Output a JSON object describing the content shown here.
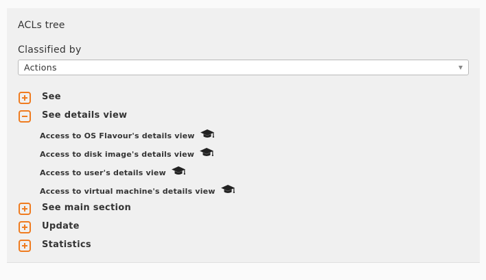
{
  "panel": {
    "title": "ACLs tree"
  },
  "classification": {
    "label": "Classified by",
    "selected": "Actions"
  },
  "tree": [
    {
      "label": "See",
      "expanded": false,
      "icon": "plus-square-icon"
    },
    {
      "label": "See details view",
      "expanded": true,
      "icon": "minus-square-icon",
      "children": [
        {
          "label": "Access to OS Flavour's details view",
          "icon": "graduation-cap-icon"
        },
        {
          "label": "Access to disk image's details view",
          "icon": "graduation-cap-icon"
        },
        {
          "label": "Access to user's details view",
          "icon": "graduation-cap-icon"
        },
        {
          "label": "Access to virtual machine's details view",
          "icon": "graduation-cap-icon"
        }
      ]
    },
    {
      "label": "See main section",
      "expanded": false,
      "icon": "plus-square-icon"
    },
    {
      "label": "Update",
      "expanded": false,
      "icon": "plus-square-icon"
    },
    {
      "label": "Statistics",
      "expanded": false,
      "icon": "plus-square-icon"
    }
  ],
  "colors": {
    "accent": "#ef7b1f",
    "panel_bg": "#f0f0f0",
    "text": "#333333"
  }
}
